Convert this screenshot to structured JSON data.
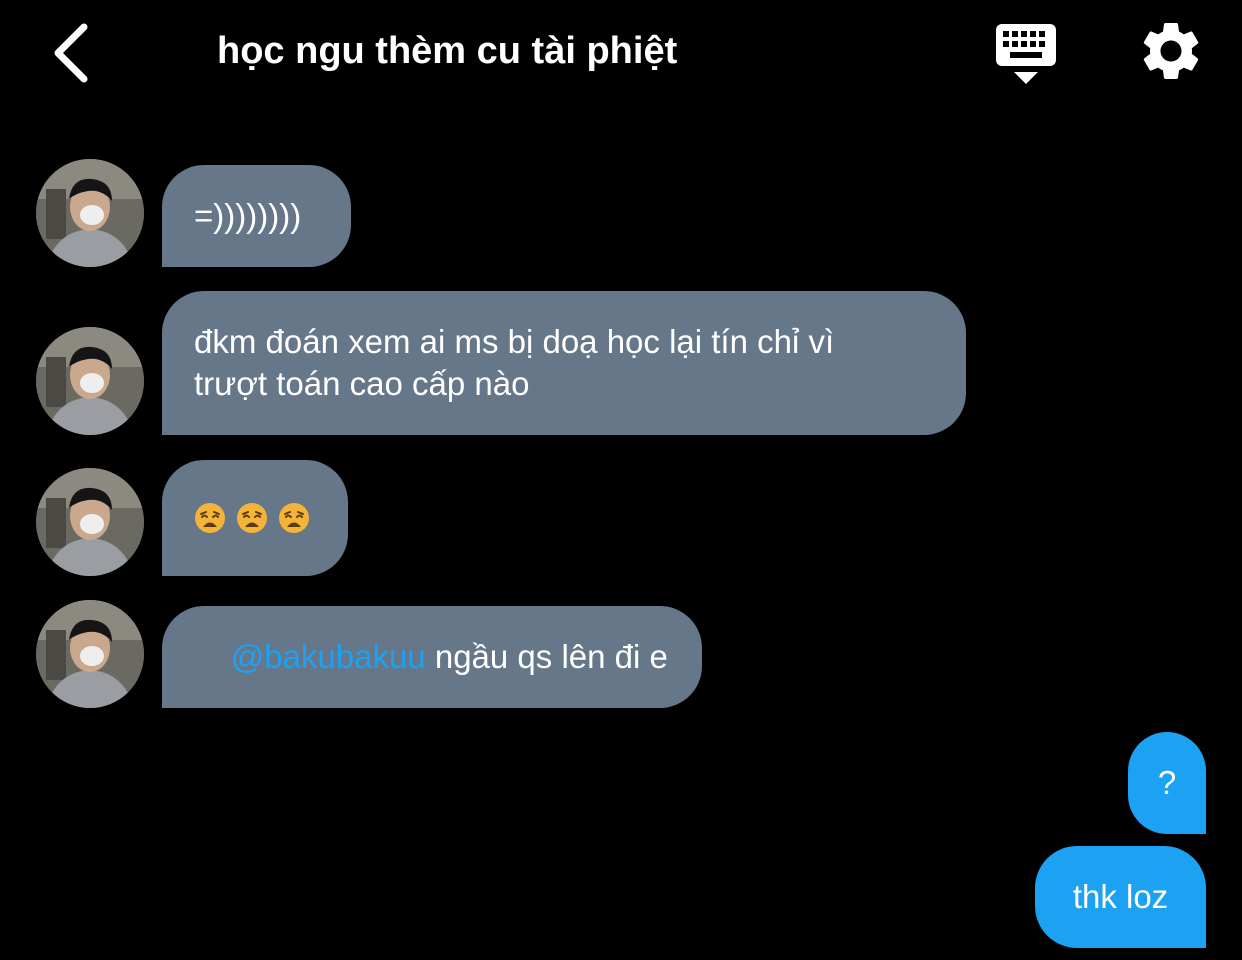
{
  "header": {
    "title": "học ngu thèm cu tài phiệt",
    "back_icon": "chevron-left-icon",
    "keyboard_icon": "keyboard-hide-icon",
    "settings_icon": "gear-icon"
  },
  "colors": {
    "background": "#000000",
    "incoming_bubble": "#66778a",
    "outgoing_bubble": "#1da1f2",
    "mention": "#1da1f2",
    "text": "#ffffff"
  },
  "messages": [
    {
      "side": "incoming",
      "text": "=))))))))"
    },
    {
      "side": "incoming",
      "line1": "đkm đoán xem ai ms bị doạ học lại tín chỉ vì",
      "line2": "trượt toán cao cấp nào"
    },
    {
      "side": "incoming",
      "emoji": [
        "weary-face-emoji",
        "weary-face-emoji",
        "weary-face-emoji"
      ]
    },
    {
      "side": "incoming",
      "mention": "@bakubakuu",
      "text": " ngầu qs lên đi e"
    },
    {
      "side": "outgoing",
      "text": "?"
    },
    {
      "side": "outgoing",
      "text": "thk loz"
    }
  ]
}
